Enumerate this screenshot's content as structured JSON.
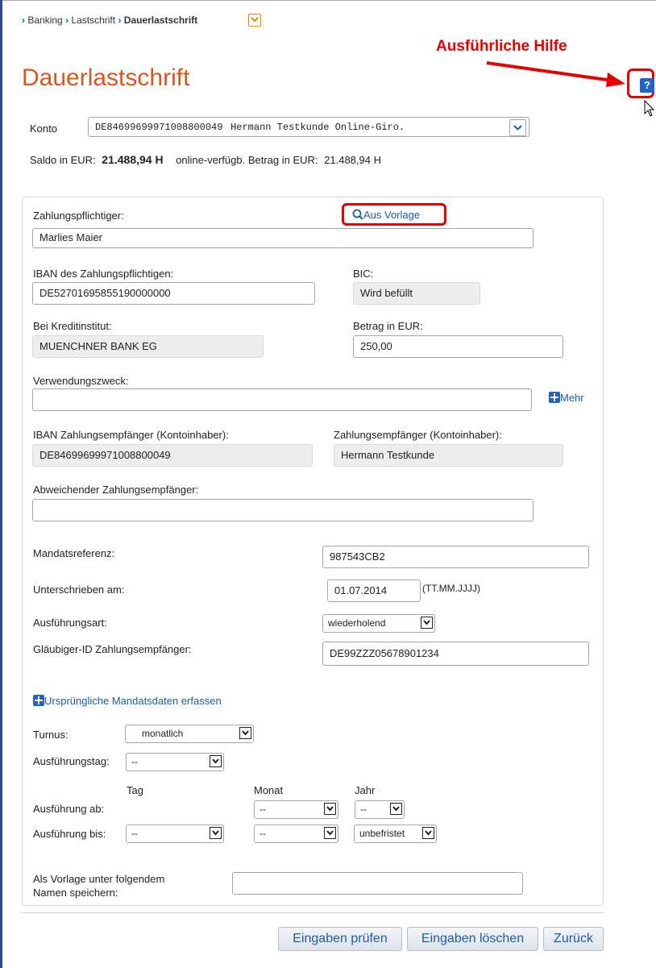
{
  "breadcrumb": {
    "items": [
      "Banking",
      "Lastschrift"
    ],
    "current": "Dauerlastschrift"
  },
  "page_title": "Dauerlastschrift",
  "annotation": {
    "help_label": "Ausführliche Hilfe"
  },
  "help_button": {
    "icon": "question-icon",
    "label": "?"
  },
  "account": {
    "label": "Konto",
    "value_iban": "DE84699699971008800049",
    "value_rest": "Hermann Testkunde  Online-Giro.",
    "balance_label": "Saldo in EUR:",
    "balance_value": "21.488,94 H",
    "available_label": "online-verfügb. Betrag in EUR:",
    "available_value": "21.488,94 H"
  },
  "form": {
    "payer_label": "Zahlungspflichtiger:",
    "from_template_link": "Aus Vorlage",
    "payer_value": "Marlies Maier",
    "payer_iban_label": "IBAN des Zahlungspflichtigen:",
    "payer_iban_value": "DE52701695855190000000",
    "bic_label": "BIC:",
    "bic_value": "Wird befüllt",
    "bank_label": "Bei Kreditinstitut:",
    "bank_value": "MUENCHNER BANK EG",
    "amount_label": "Betrag in EUR:",
    "amount_value": "250,00",
    "purpose_label": "Verwendungszweck:",
    "purpose_value": "",
    "more_link": "Mehr",
    "payee_iban_label": "IBAN Zahlungsempfänger (Kontoinhaber):",
    "payee_iban_value": "DE84699699971008800049",
    "payee_label": "Zahlungsempfänger (Kontoinhaber):",
    "payee_value": "Hermann Testkunde",
    "alt_payee_label": "Abweichender Zahlungsempfänger:",
    "alt_payee_value": "",
    "mandate_ref_label": "Mandatsreferenz:",
    "mandate_ref_value": "987543CB2",
    "signed_label": "Unterschrieben am:",
    "signed_value": "01.07.2014",
    "signed_hint": "(TT.MM.JJJJ)",
    "exec_type_label": "Ausführungsart:",
    "exec_type_value": "wiederholend",
    "creditor_id_label": "Gläubiger-ID Zahlungsempfänger:",
    "creditor_id_value": "DE99ZZZ05678901234",
    "original_mandate_link": "Ursprüngliche Mandatsdaten erfassen",
    "interval_label": "Turnus:",
    "interval_value": "monatlich",
    "exec_day_label": "Ausführungstag:",
    "exec_day_value": "--",
    "col_day": "Tag",
    "col_month": "Monat",
    "col_year": "Jahr",
    "exec_from_label": "Ausführung ab:",
    "exec_from_month": "--",
    "exec_from_year": "--",
    "exec_to_label": "Ausführung bis:",
    "exec_to_day": "--",
    "exec_to_month": "--",
    "exec_to_year": "unbefristet",
    "template_save_label_1": "Als Vorlage unter folgendem",
    "template_save_label_2": "Namen speichern:",
    "template_save_value": ""
  },
  "buttons": {
    "check": "Eingaben prüfen",
    "clear": "Eingaben löschen",
    "back": "Zurück"
  },
  "colors": {
    "title": "#d9571b",
    "link": "#1a5ea8",
    "annotation": "#e60000",
    "icon_blue": "#1f64c8"
  }
}
